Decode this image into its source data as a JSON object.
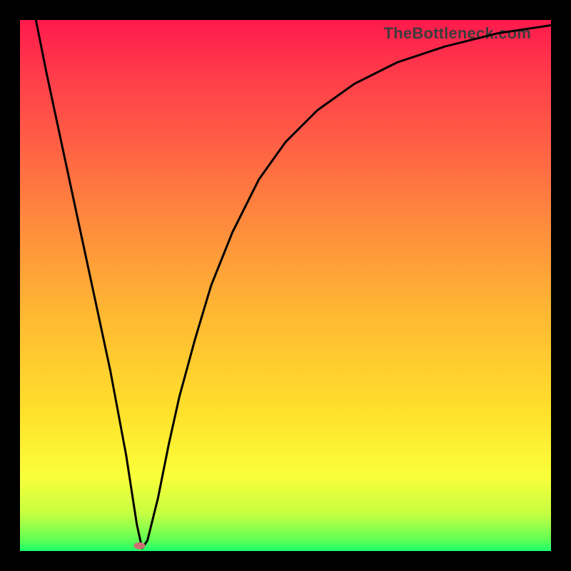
{
  "watermark": "TheBottleneck.com",
  "colors": {
    "background": "#000000",
    "gradient_css": "linear-gradient(to bottom, #ff1a4d 0%, #ff3b4a 10%, #ff5c45 22%, #ff8a3d 38%, #ffb733 55%, #ffe12b 74%, #faff3a 86%, #c6ff41 93%, #5eff55 98%, #1aff6b 100%)",
    "curve": "#000000",
    "marker": "#cc6e74"
  },
  "chart_data": {
    "type": "line",
    "title": "",
    "xlabel": "",
    "ylabel": "",
    "xlim": [
      0,
      100
    ],
    "ylim": [
      0,
      100
    ],
    "grid": false,
    "legend": null,
    "marker": {
      "x": 22.5,
      "y": 1.0
    },
    "series": [
      {
        "name": "bottleneck-curve",
        "x": [
          3,
          5,
          8,
          11,
          14,
          17,
          20,
          22,
          23,
          24,
          26,
          28,
          30,
          33,
          36,
          40,
          45,
          50,
          56,
          63,
          71,
          80,
          90,
          100
        ],
        "y": [
          100,
          90,
          76,
          62,
          48,
          34,
          18,
          5,
          0.5,
          2,
          10,
          20,
          29,
          40,
          50,
          60,
          70,
          77,
          83,
          88,
          92,
          95,
          97.5,
          99
        ]
      }
    ]
  }
}
